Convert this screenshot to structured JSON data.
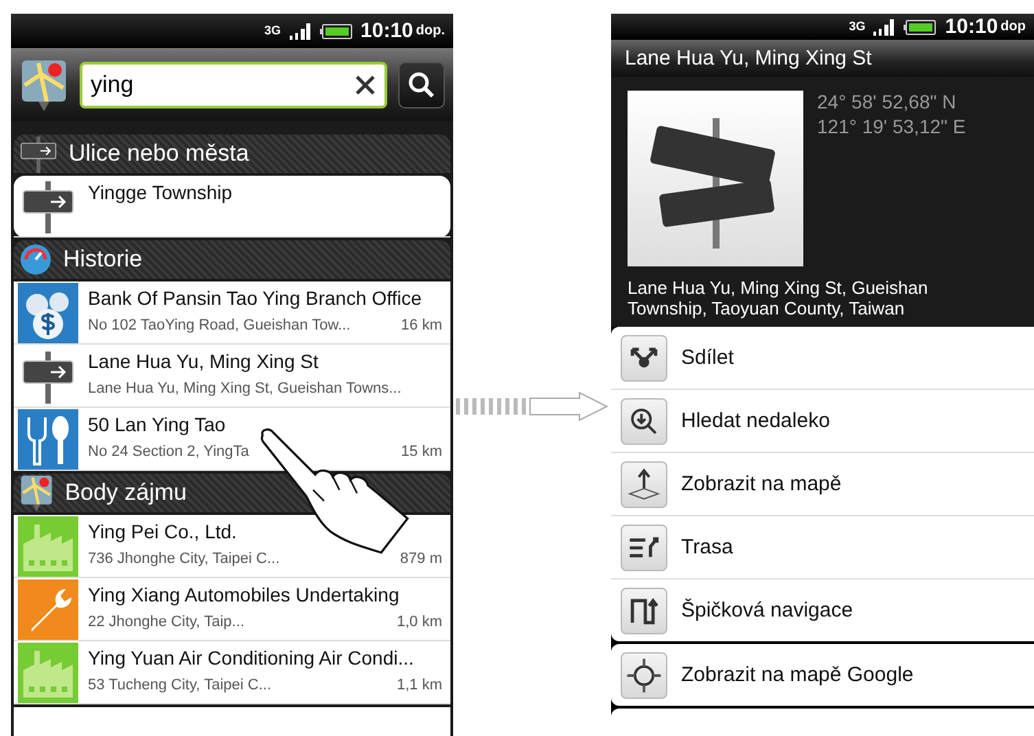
{
  "search_screen": {
    "status_bar": {
      "network": "3G",
      "time": "10:10",
      "period": "dop."
    },
    "search": {
      "value": "ying"
    },
    "sections": [
      {
        "kind": "streets",
        "title": "Ulice nebo města",
        "items": [
          {
            "kind": "sign",
            "title": "Yingge  Township"
          }
        ]
      },
      {
        "kind": "history",
        "title": "Historie",
        "items": [
          {
            "kind": "money",
            "title": "Bank Of Pansin Tao Ying Branch Office",
            "subtitle": "No 102 TaoYing Road, Gueishan  Tow...",
            "distance": "16 km"
          },
          {
            "kind": "sign",
            "title": "Lane Hua Yu, Ming Xing St",
            "subtitle": "Lane Hua Yu, Ming Xing St, Gueishan  Towns..."
          },
          {
            "kind": "food",
            "title": "50 Lan Ying Tao",
            "subtitle": "No 24 Section 2, YingTa",
            "distance": "15 km"
          }
        ]
      },
      {
        "kind": "poi",
        "title": "Body zájmu",
        "items": [
          {
            "kind": "factory",
            "title": "Ying Pei Co., Ltd.",
            "subtitle": "736 Jhonghe  City, Taipei C...",
            "distance": "879 m"
          },
          {
            "kind": "wrench",
            "title": "Ying Xiang Automobiles Undertaking",
            "subtitle": "22 Jhonghe  City, Taip...",
            "distance": "1,0 km"
          },
          {
            "kind": "factory",
            "title": "Ying Yuan Air Conditioning Air Condi...",
            "subtitle": "53 Tucheng  City, Taipei C...",
            "distance": "1,1 km"
          }
        ]
      }
    ]
  },
  "detail_screen": {
    "status_bar": {
      "network": "3G",
      "time": "10:10",
      "period": "dop"
    },
    "title": "Lane Hua Yu, Ming Xing St",
    "coordinates": [
      "24° 58' 52,68\" N",
      "121° 19' 53,12\" E"
    ],
    "address": "Lane Hua Yu, Ming Xing St, Gueishan Township, Taoyuan County, Taiwan",
    "action_groups": [
      [
        {
          "kind": "share",
          "label": "Sdílet"
        },
        {
          "kind": "nearby",
          "label": "Hledat nedaleko"
        },
        {
          "kind": "map",
          "label": "Zobrazit na mapě"
        },
        {
          "kind": "route",
          "label": "Trasa"
        },
        {
          "kind": "navigation",
          "label": "Špičková navigace"
        }
      ],
      [
        {
          "kind": "google",
          "label": "Zobrazit na mapě Google"
        }
      ]
    ]
  }
}
